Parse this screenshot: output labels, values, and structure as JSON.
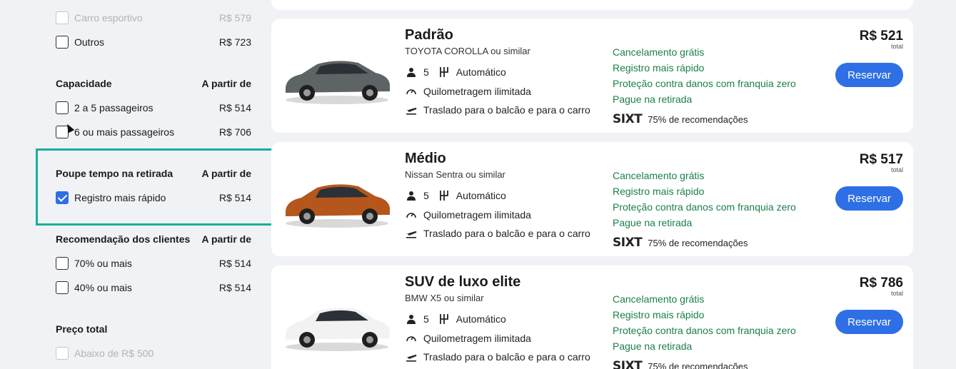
{
  "filters": {
    "top_rows": [
      {
        "label": "Carro esportivo",
        "price": "R$ 579",
        "faded": true
      },
      {
        "label": "Outros",
        "price": "R$ 723",
        "faded": false
      }
    ],
    "capacity": {
      "title": "Capacidade",
      "from_label": "A partir de",
      "items": [
        {
          "label": "2 a 5 passageiros",
          "price": "R$ 514"
        },
        {
          "label": "6 ou mais passageiros",
          "price": "R$ 706"
        }
      ]
    },
    "save_time": {
      "title": "Poupe tempo na retirada",
      "from_label": "A partir de",
      "items": [
        {
          "label": "Registro mais rápido",
          "price": "R$ 514",
          "checked": true
        }
      ]
    },
    "recommendation": {
      "title": "Recomendação dos clientes",
      "from_label": "A partir de",
      "items": [
        {
          "label": "70% ou mais",
          "price": "R$ 514"
        },
        {
          "label": "40% ou mais",
          "price": "R$ 514"
        }
      ]
    },
    "total_price": {
      "title": "Preço total",
      "items": [
        {
          "label": "Abaixo de R$ 500",
          "faded": true
        }
      ]
    }
  },
  "cards": [
    {
      "category": "Padrão",
      "model": "TOYOTA COROLLA ou similar",
      "seats": "5",
      "transmission": "Automático",
      "mileage": "Quilometragem ilimitada",
      "shuttle": "Traslado para o balcão e para o carro",
      "benefits": [
        "Cancelamento grátis",
        "Registro mais rápido",
        "Proteção contra danos com franquia zero",
        "Pague na retirada"
      ],
      "supplier_logo": "SIXT",
      "recommendation": "75% de recomendações",
      "price": "R$ 521",
      "price_label": "total",
      "button": "Reservar",
      "car_color": "#5e6366"
    },
    {
      "category": "Médio",
      "model": "Nissan Sentra ou similar",
      "seats": "5",
      "transmission": "Automático",
      "mileage": "Quilometragem ilimitada",
      "shuttle": "Traslado para o balcão e para o carro",
      "benefits": [
        "Cancelamento grátis",
        "Registro mais rápido",
        "Proteção contra danos com franquia zero",
        "Pague na retirada"
      ],
      "supplier_logo": "SIXT",
      "recommendation": "75% de recomendações",
      "price": "R$ 517",
      "price_label": "total",
      "button": "Reservar",
      "car_color": "#b5561c"
    },
    {
      "category": "SUV de luxo elite",
      "model": "BMW X5 ou similar",
      "seats": "5",
      "transmission": "Automático",
      "mileage": "Quilometragem ilimitada",
      "shuttle": "Traslado para o balcão e para o carro",
      "benefits": [
        "Cancelamento grátis",
        "Registro mais rápido",
        "Proteção contra danos com franquia zero",
        "Pague na retirada"
      ],
      "supplier_logo": "SIXT",
      "recommendation": "75% de recomendações",
      "price": "R$ 786",
      "price_label": "total",
      "button": "Reservar",
      "car_color": "#f2f2f2"
    }
  ],
  "colors": {
    "accent": "#2e6fe6",
    "benefit_green": "#1b7f4a",
    "highlight": "#17b09a"
  }
}
